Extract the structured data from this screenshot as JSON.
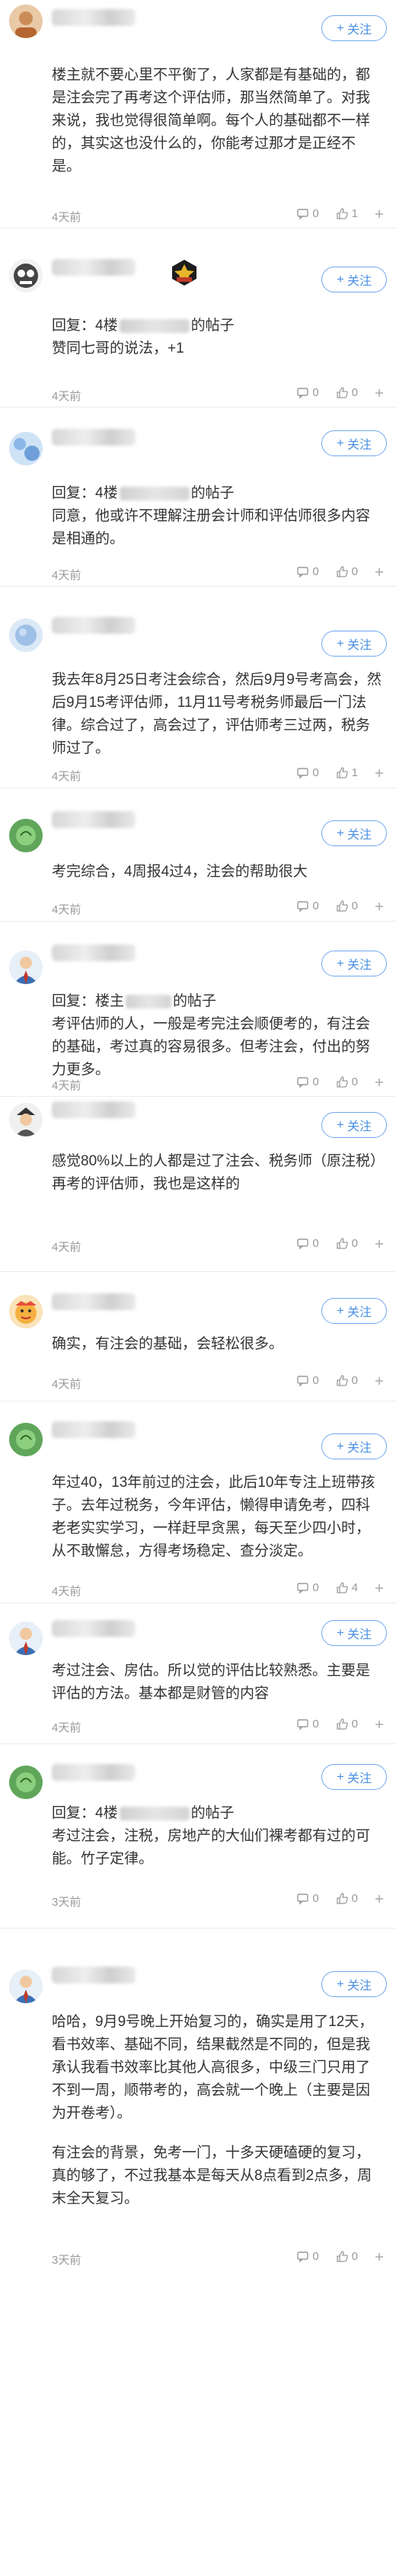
{
  "labels": {
    "follow": "关注",
    "follow_plus": "+",
    "reply_prefix": "回复：",
    "post_suffix": "的帖子"
  },
  "posts": [
    {
      "reply_to": null,
      "paragraphs": [
        "楼主就不要心里不平衡了，人家都是有基础的，都是注会完了再考这个评估师，那当然简单了。对我来说，我也觉得很简单啊。每个人的基础都不一样的，其实这也没什么的，你能考过那才是正经不是。"
      ],
      "time": "4天前",
      "comments": "0",
      "likes": "1"
    },
    {
      "reply_to": "4楼",
      "paragraphs": [
        "赞同七哥的说法，+1"
      ],
      "time": "4天前",
      "comments": "0",
      "likes": "0"
    },
    {
      "reply_to": "4楼",
      "paragraphs": [
        "同意，他或许不理解注册会计师和评估师很多内容是相通的。"
      ],
      "time": "4天前",
      "comments": "0",
      "likes": "0"
    },
    {
      "reply_to": null,
      "paragraphs": [
        "我去年8月25日考注会综合，然后9月9号考高会，然后9月15考评估师，11月11号考税务师最后一门法律。综合过了，高会过了，评估师考三过两，税务师过了。"
      ],
      "time": "4天前",
      "comments": "0",
      "likes": "1"
    },
    {
      "reply_to": null,
      "paragraphs": [
        "考完综合，4周报4过4，注会的帮助很大"
      ],
      "time": "4天前",
      "comments": "0",
      "likes": "0"
    },
    {
      "reply_to": "楼主",
      "paragraphs": [
        "考评估师的人，一般是考完注会顺便考的，有注会的基础，考过真的容易很多。但考注会，付出的努力更多。"
      ],
      "time": "4天前",
      "comments": "0",
      "likes": "0"
    },
    {
      "reply_to": null,
      "paragraphs": [
        "感觉80%以上的人都是过了注会、税务师（原注税）再考的评估师，我也是这样的"
      ],
      "time": "4天前",
      "comments": "0",
      "likes": "0"
    },
    {
      "reply_to": null,
      "paragraphs": [
        "确实，有注会的基础，会轻松很多。"
      ],
      "time": "4天前",
      "comments": "0",
      "likes": "0"
    },
    {
      "reply_to": null,
      "paragraphs": [
        "年过40，13年前过的注会，此后10年专注上班带孩子。去年过税务，今年评估，懒得申请免考，四科老老实实学习，一样赶早贪黑，每天至少四小时，从不敢懈怠，方得考场稳定、查分淡定。"
      ],
      "time": "4天前",
      "comments": "0",
      "likes": "4"
    },
    {
      "reply_to": null,
      "paragraphs": [
        "考过注会、房估。所以觉的评估比较熟悉。主要是评估的方法。基本都是财管的内容"
      ],
      "time": "4天前",
      "comments": "0",
      "likes": "0"
    },
    {
      "reply_to": "4楼",
      "paragraphs": [
        "考过注会，注税，房地产的大仙们裸考都有过的可能。竹子定律。"
      ],
      "time": "3天前",
      "comments": "0",
      "likes": "0"
    },
    {
      "reply_to": null,
      "paragraphs": [
        "哈哈，9月9号晚上开始复习的，确实是用了12天，看书效率、基础不同，结果截然是不同的，但是我承认我看书效率比其他人高很多，中级三门只用了不到一周，顺带考的，高会就一个晚上（主要是因为开卷考）。",
        "有注会的背景，免考一门，十多天硬磕硬的复习，真的够了，不过我基本是每天从8点看到2点多，周末全天复习。"
      ],
      "time": "3天前",
      "comments": "0",
      "likes": "0"
    }
  ]
}
